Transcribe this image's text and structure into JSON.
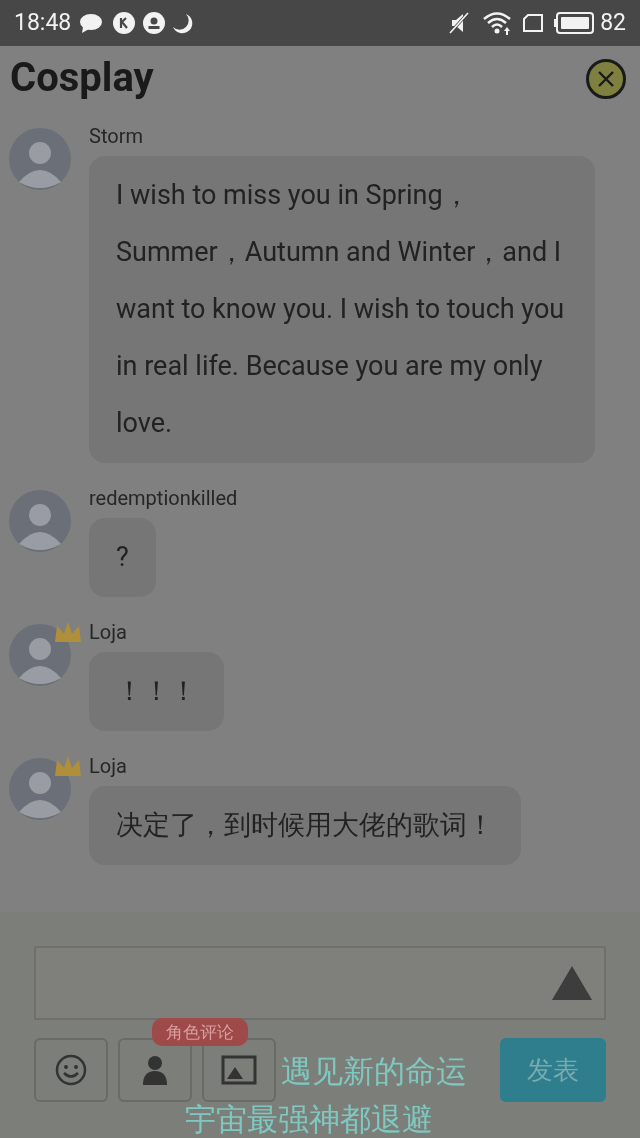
{
  "status_bar": {
    "time": "18:48",
    "battery": "82"
  },
  "header": {
    "title": "Cosplay"
  },
  "messages": [
    {
      "name": "Storm",
      "crown": false,
      "text": "I wish to miss you in Spring，Summer，Autumn and Winter，and I want to know you. I wish to touch you in real life. Because you are my only love."
    },
    {
      "name": "redemptionkilled",
      "crown": false,
      "text": "?"
    },
    {
      "name": "Loja",
      "crown": true,
      "text": "！！！"
    },
    {
      "name": "Loja",
      "crown": true,
      "text": "决定了，到时候用大佬的歌词！"
    }
  ],
  "composer": {
    "badge": "角色评论",
    "send": "发表"
  },
  "lyrics": [
    "遇见新的命运",
    "宇宙最强神都退避"
  ]
}
